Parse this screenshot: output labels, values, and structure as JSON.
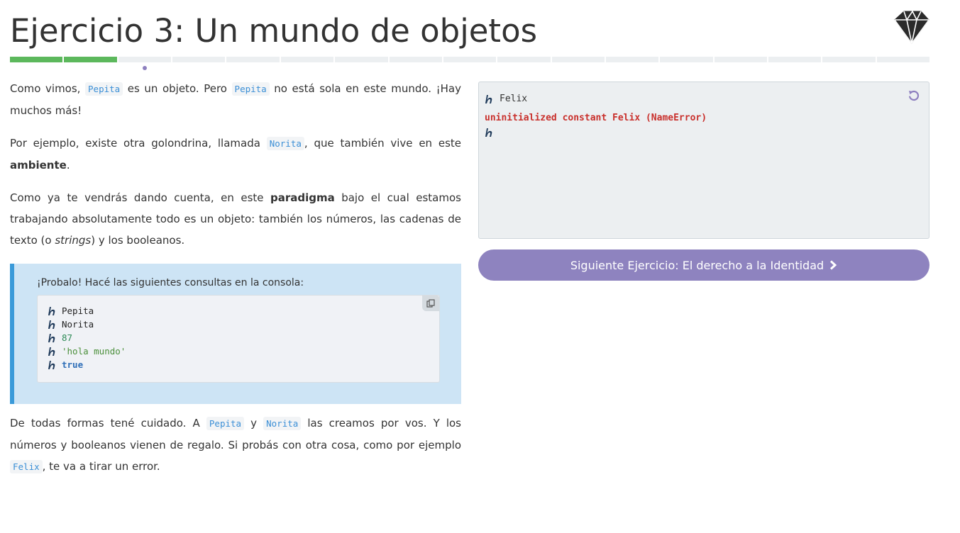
{
  "header": {
    "title": "Ejercicio 3: Un mundo de objetos",
    "logo_icon": "ruby-gem-icon"
  },
  "progress": {
    "total_steps": 17,
    "completed_steps": 2,
    "current_step": 3,
    "completed_color": "#5cb85c",
    "pending_color": "#eceff1",
    "current_marker_color": "#8e80bf"
  },
  "explanation": {
    "p1": {
      "t1": "Como vimos, ",
      "c1": "Pepita",
      "t2": " es un objeto. Pero ",
      "c2": "Pepita",
      "t3": " no está sola en este mundo. ¡Hay muchos más!"
    },
    "p2": {
      "t1": "Por ejemplo, existe otra golondrina, llamada ",
      "c1": "Norita",
      "t2": ", que también vive en este ",
      "b1": "ambiente",
      "t3": "."
    },
    "p3": {
      "t1": "Como ya te vendrás dando cuenta, en este ",
      "b1": "paradigma",
      "t2": " bajo el cual estamos trabajando absolutamente todo es un objeto: también los números, las cadenas de texto (o ",
      "i1": "strings",
      "t3": ") y los booleanos."
    },
    "p4": {
      "t1": "De todas formas tené cuidado. A ",
      "c1": "Pepita",
      "t2": " y ",
      "c2": "Norita",
      "t3": " las creamos por vos. Y los números y booleanos vienen de regalo. Si probás con otra cosa, como por ejemplo ",
      "c3": "Felix",
      "t4": ", te va a tirar un error."
    }
  },
  "tip": {
    "title": "¡Probalo! Hacé las siguientes consultas en la consola:",
    "lines": [
      "Pepita",
      "Norita",
      "87",
      "'hola mundo'",
      "true"
    ],
    "copy_icon": "copy-icon",
    "prompt_icon": "mumuki-prompt-icon"
  },
  "console": {
    "input": "Felix",
    "error": "uninitialized constant Felix (NameError)",
    "reset_icon": "reset-icon",
    "background": "#eceff1",
    "error_color": "#c9302c"
  },
  "next_button": {
    "label": "Siguiente Ejercicio: El derecho a la Identidad",
    "icon": "chevron-right-icon",
    "color": "#8e83bf"
  }
}
